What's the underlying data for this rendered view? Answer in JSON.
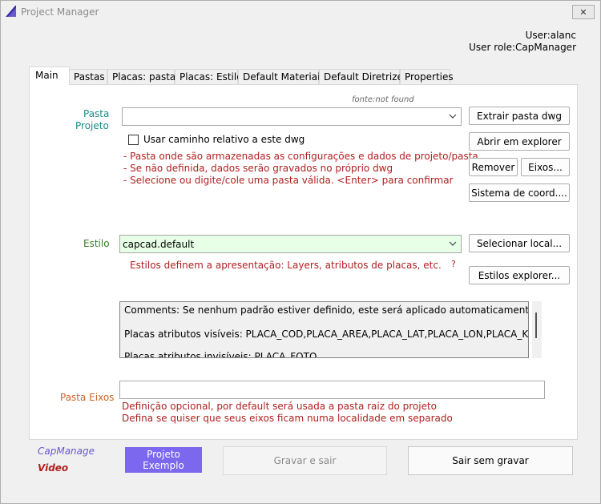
{
  "window": {
    "title": "Project Manager",
    "close_label": "✕"
  },
  "user": {
    "name_line": "User:alanc",
    "role_line": "User role:CapManager"
  },
  "tabs": [
    "Main",
    "Pastas",
    "Placas: pastas",
    "Placas: Estilo",
    "Default Materiais",
    "Default Diretrizes",
    "Properties"
  ],
  "main": {
    "font_note": "fonte:not found",
    "pasta_label_1": "Pasta",
    "pasta_label_2": "Projeto",
    "pasta_value": "",
    "checkbox_label": "Usar caminho relativo a este dwg",
    "pasta_help": [
      "- Pasta onde são armazenadas as configurações e dados de projeto/pasta",
      "- Se não definida, dados serão gravados no próprio dwg",
      "- Selecione ou digite/cole uma pasta válida. <Enter> para confirmar"
    ],
    "buttons": {
      "extrair": "Extrair pasta dwg",
      "abrir": "Abrir em explorer",
      "remover": "Remover",
      "eixos": "Eixos...",
      "sistema": "Sistema de coord....",
      "selecionar": "Selecionar local...",
      "estilos_explorer": "Estilos explorer..."
    },
    "estilo_label": "Estilo",
    "estilo_value": "capcad.default",
    "estilo_help": "Estilos definem a apresentação: Layers, atributos de placas, etc.",
    "estilo_question": "?",
    "memo_lines": [
      "Comments: Se nenhum padrão estiver definido, este será aplicado automaticamente",
      "Placas atributos visíveis: PLACA_COD,PLACA_AREA,PLACA_LAT,PLACA_LON,PLACA_KM",
      "Placas atributos invisíveis: PLACA_FOTO"
    ],
    "eixos_label": "Pasta Eixos",
    "eixos_value": "",
    "eixos_help": [
      "Definição opcional, por default será usada a pasta raiz do projeto",
      "Defina se quiser que seus eixos ficam numa localidade em separado"
    ]
  },
  "footer": {
    "capmanage": "CapManage",
    "video": "Video",
    "projeto_1": "Projeto",
    "projeto_2": "Exemplo",
    "gravar": "Gravar e sair",
    "sair": "Sair sem gravar"
  },
  "colors": {
    "accent": "#7b68ee",
    "help_red": "#b02020",
    "teal": "#1b8a8a",
    "estilo_bg": "#e6ffe6"
  }
}
